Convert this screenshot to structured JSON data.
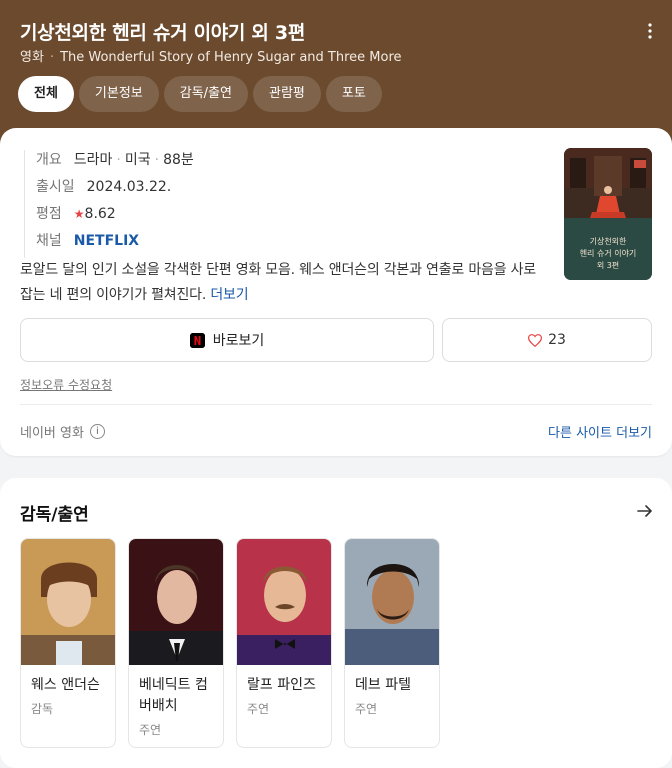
{
  "header": {
    "title": "기상천외한 헨리 슈거 이야기 외 3편",
    "subtitle_genre": "영화",
    "subtitle_original": "The Wonderful Story of Henry Sugar and Three More",
    "tabs": [
      "전체",
      "기본정보",
      "감독/출연",
      "관람평",
      "포토"
    ]
  },
  "info": {
    "overview_label": "개요",
    "genre": "드라마",
    "country": "미국",
    "runtime": "88분",
    "release_label": "출시일",
    "release_date": "2024.03.22.",
    "rating_label": "평점",
    "rating_star": "★",
    "rating_value": "8.62",
    "channel_label": "채널",
    "channel_value": "NETFLIX"
  },
  "poster": {
    "line1": "기상천외한",
    "line2": "헨리 슈거 이야기",
    "line3": "외 3편"
  },
  "description": {
    "text": "로알드 달의 인기 소설을 각색한 단편 영화 모음. 웨스 앤더슨의 각본과 연출로 마음을 사로잡는 네 편의 이야기가 펼쳐진다.",
    "more_label": "더보기"
  },
  "actions": {
    "watch_label": "바로보기",
    "like_count": "23",
    "edit_request": "정보오류 수정요청",
    "source_label": "네이버 영화",
    "other_sites": "다른 사이트 더보기"
  },
  "cast_section": {
    "title": "감독/출연",
    "people": [
      {
        "name": "웨스 앤더슨",
        "role": "감독"
      },
      {
        "name": "베네딕트 컴버배치",
        "role": "주연"
      },
      {
        "name": "랄프 파인즈",
        "role": "주연"
      },
      {
        "name": "데브 파텔",
        "role": "주연"
      }
    ]
  },
  "colors": {
    "header_bg": "#6b4a2e",
    "link": "#1a5aa8",
    "star": "#e84343",
    "netflix": "#e50914"
  },
  "icons": {
    "more": "more-vertical-icon",
    "info": "info-circle-icon",
    "heart": "heart-icon",
    "arrow": "arrow-right-icon",
    "netflix": "netflix-logo-icon"
  }
}
